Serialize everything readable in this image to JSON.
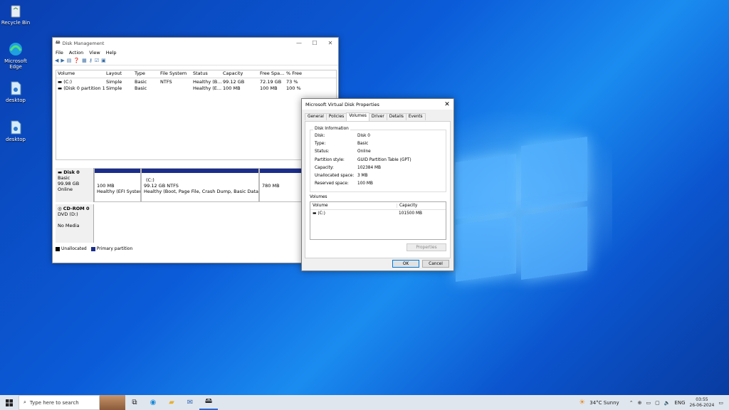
{
  "desktop": {
    "icons": [
      {
        "label": "Recycle Bin",
        "icon": "recycle-bin-icon"
      },
      {
        "label": "Microsoft Edge",
        "icon": "edge-icon"
      },
      {
        "label": "desktop",
        "icon": "file-icon"
      },
      {
        "label": "desktop",
        "icon": "file-icon"
      }
    ]
  },
  "disk_management": {
    "title": "Disk Management",
    "menu": [
      "File",
      "Action",
      "View",
      "Help"
    ],
    "columns": [
      "Volume",
      "Layout",
      "Type",
      "File System",
      "Status",
      "Capacity",
      "Free Spa...",
      "% Free"
    ],
    "rows": [
      [
        "(C:)",
        "Simple",
        "Basic",
        "NTFS",
        "Healthy (B...",
        "99.12 GB",
        "72.19 GB",
        "73 %"
      ],
      [
        "(Disk 0 partition 1)",
        "Simple",
        "Basic",
        "",
        "Healthy (E...",
        "100 MB",
        "100 MB",
        "100 %"
      ]
    ],
    "disk0": {
      "name": "Disk 0",
      "type": "Basic",
      "size": "99.98 GB",
      "state": "Online",
      "part1_size": "100 MB",
      "part1_status": "Healthy (EFI System",
      "part2_name": "(C:)",
      "part2_size": "99.12 GB NTFS",
      "part2_status": "Healthy (Boot, Page File, Crash Dump, Basic Data Partitio",
      "part3_size": "780 MB"
    },
    "cdrom": {
      "name": "CD-ROM 0",
      "drive": "DVD (D:)",
      "media": "No Media"
    },
    "legend": {
      "unallocated": "Unallocated",
      "primary": "Primary partition"
    }
  },
  "dialog": {
    "title": "Microsoft Virtual Disk Properties",
    "tabs": [
      "General",
      "Policies",
      "Volumes",
      "Driver",
      "Details",
      "Events"
    ],
    "active_tab": "Volumes",
    "disk_info_title": "Disk Information",
    "info": [
      {
        "k": "Disk:",
        "v": "Disk 0"
      },
      {
        "k": "Type:",
        "v": "Basic"
      },
      {
        "k": "Status:",
        "v": "Online"
      },
      {
        "k": "Partition style:",
        "v": "GUID Partition Table (GPT)"
      },
      {
        "k": "Capacity:",
        "v": "102384 MB"
      },
      {
        "k": "Unallocated space:",
        "v": "3 MB"
      },
      {
        "k": "Reserved space:",
        "v": "100 MB"
      }
    ],
    "volumes_title": "Volumes",
    "vol_columns": [
      "Volume",
      "Capacity"
    ],
    "vol_rows": [
      {
        "volume": "(C:)",
        "capacity": "101500 MB"
      }
    ],
    "properties_btn": "Properties",
    "ok_btn": "OK",
    "cancel_btn": "Cancel"
  },
  "taskbar": {
    "search_placeholder": "Type here to search",
    "weather": "34°C  Sunny",
    "lang": "ENG",
    "time": "03:55",
    "date": "26-06-2024"
  },
  "colors": {
    "primary_partition": "#1a2d8c",
    "unallocated": "#000000"
  }
}
